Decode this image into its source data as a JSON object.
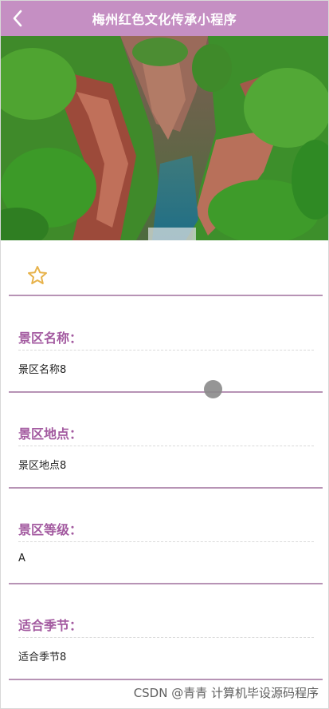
{
  "header": {
    "title": "梅州红色文化传承小程序",
    "back_icon": "chevron-left-icon"
  },
  "banner": {
    "alt": "",
    "icon": "scenic-photo"
  },
  "favorite": {
    "icon": "star-outline-icon"
  },
  "fields": [
    {
      "label": "景区名称：",
      "value": "景区名称8"
    },
    {
      "label": "景区地点：",
      "value": "景区地点8"
    },
    {
      "label": "景区等级：",
      "value": "A"
    },
    {
      "label": "适合季节：",
      "value": "适合季节8"
    }
  ],
  "watermark": "CSDN @青青  计算机毕设源码程序",
  "colors": {
    "header_bg": "#c58fc3",
    "label": "#a35aa0",
    "rule": "#b793b5",
    "star": "#e7b24a"
  }
}
